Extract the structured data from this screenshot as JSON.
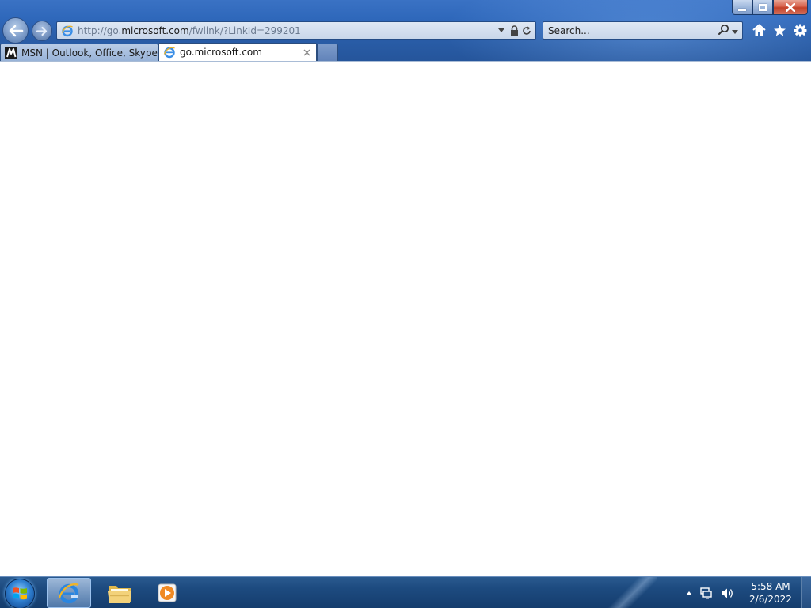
{
  "browser": {
    "window_controls": {
      "minimize": "minimize",
      "maximize": "restore",
      "close": "close"
    },
    "address": {
      "url_prefix": "http://go.",
      "url_domain": "microsoft.com",
      "url_path": "/fwlink/?LinkId=299201"
    },
    "search": {
      "placeholder": "Search..."
    },
    "tabs": [
      {
        "label": "MSN | Outlook, Office, Skype, ...",
        "active": false
      },
      {
        "label": "go.microsoft.com",
        "active": true
      }
    ]
  },
  "taskbar": {
    "apps": [
      {
        "name": "Internet Explorer",
        "active": true
      },
      {
        "name": "Windows Explorer",
        "active": false
      },
      {
        "name": "Windows Media Player",
        "active": false
      }
    ],
    "clock": {
      "time": "5:58 AM",
      "date": "2/6/2022"
    }
  },
  "colors": {
    "chrome": "#2f68bb",
    "taskbar": "#1d4b80",
    "close_button": "#c24027"
  }
}
